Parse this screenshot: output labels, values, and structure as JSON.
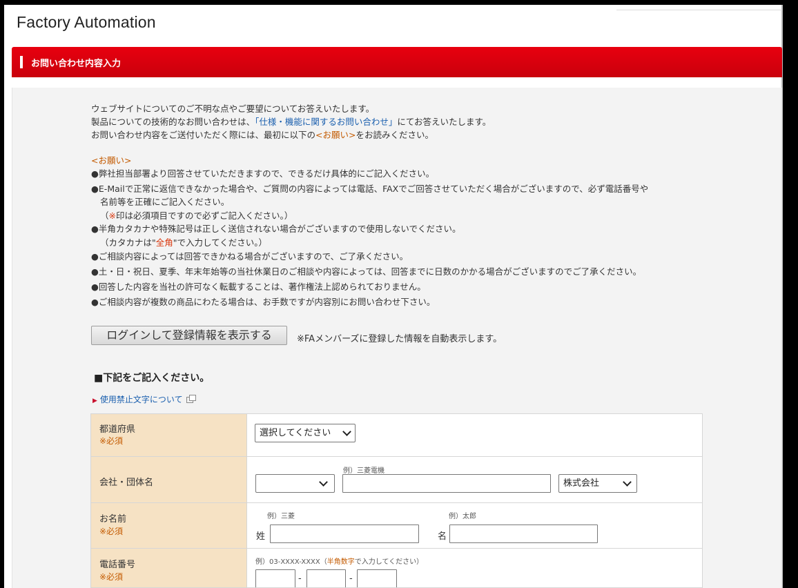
{
  "site": {
    "title": "Factory Automation"
  },
  "banner": {
    "title": "お問い合わせ内容入力"
  },
  "intro": {
    "line1": "ウェブサイトについてのご不明な点やご要望についてお答えいたします。",
    "line2_pre": "製品についての技術的なお問い合わせは、",
    "line2_link": "「仕様・機能に関するお問い合わせ」",
    "line2_post": "にてお答えいたします。",
    "line3_pre": "お問い合わせ内容をご送付いただく際には、最初に以下の",
    "line3_em": "<お願い>",
    "line3_post": "をお読みください。"
  },
  "notice": {
    "title": "<お願い>",
    "item1": "●弊社担当部署より回答させていただきますので、できるだけ具体的にご記入ください。",
    "item2": "●E-Mailで正常に返信できなかった場合や、ご質問の内容によっては電話、FAXでご回答させていただく場合がございますので、必ず電話番号や",
    "item2b": "名前等を正確にご記入ください。",
    "item2c_pre": "（",
    "item2c_em": "※",
    "item2c_post": "印は必須項目ですので必ずご記入ください。）",
    "item3": "●半角カタカナや特殊記号は正しく送信されない場合がございますので使用しないでください。",
    "item3b_pre": "（カタカナは\"",
    "item3b_em": "全角",
    "item3b_post": "\"で入力してください。）",
    "item4": "●ご相談内容によっては回答できかねる場合がございますので、ご了承ください。",
    "item5": "●土・日・祝日、夏季、年末年始等の当社休業日のご相談や内容によっては、回答までに日数のかかる場合がございますのでご了承ください。",
    "item6": "●回答した内容を当社の許可なく転載することは、著作権法上認められておりません。",
    "item7": "●ご相談内容が複数の商品にわたる場合は、お手数ですが内容別にお問い合わせ下さい。"
  },
  "login": {
    "button": "ログインして登録情報を表示する",
    "note": "※FAメンバーズに登録した情報を自動表示します。"
  },
  "form": {
    "heading": "■下記をご記入ください。",
    "prohibit_link": "使用禁止文字について",
    "required": "※必須",
    "prefecture": {
      "label": "都道府県",
      "select": "選択してください"
    },
    "company": {
      "label": "会社・団体名",
      "example": "例）三菱電機",
      "type_select": "株式会社"
    },
    "name": {
      "label": "お名前",
      "last_example": "例）三菱",
      "first_example": "例）太郎",
      "last_label": "姓",
      "first_label": "名"
    },
    "phone": {
      "label": "電話番号",
      "example_pre": "例）03-XXXX-XXXX（",
      "example_em": "半角数字",
      "example_post": "で入力してください）",
      "sep": "-"
    }
  }
}
